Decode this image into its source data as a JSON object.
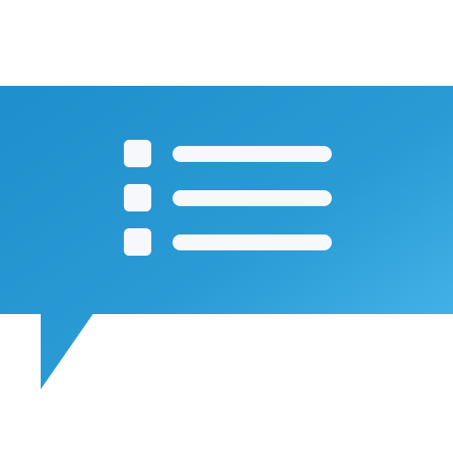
{
  "icon": {
    "name": "chat-bubble-list-icon",
    "colors": {
      "background": "#ffffff",
      "bubble_dark": "#1f8fcb",
      "bubble_mid": "#2b9bd6",
      "bubble_light": "#4ab9ec",
      "foreground": "#f7f8fb"
    },
    "list_rows": 3
  }
}
